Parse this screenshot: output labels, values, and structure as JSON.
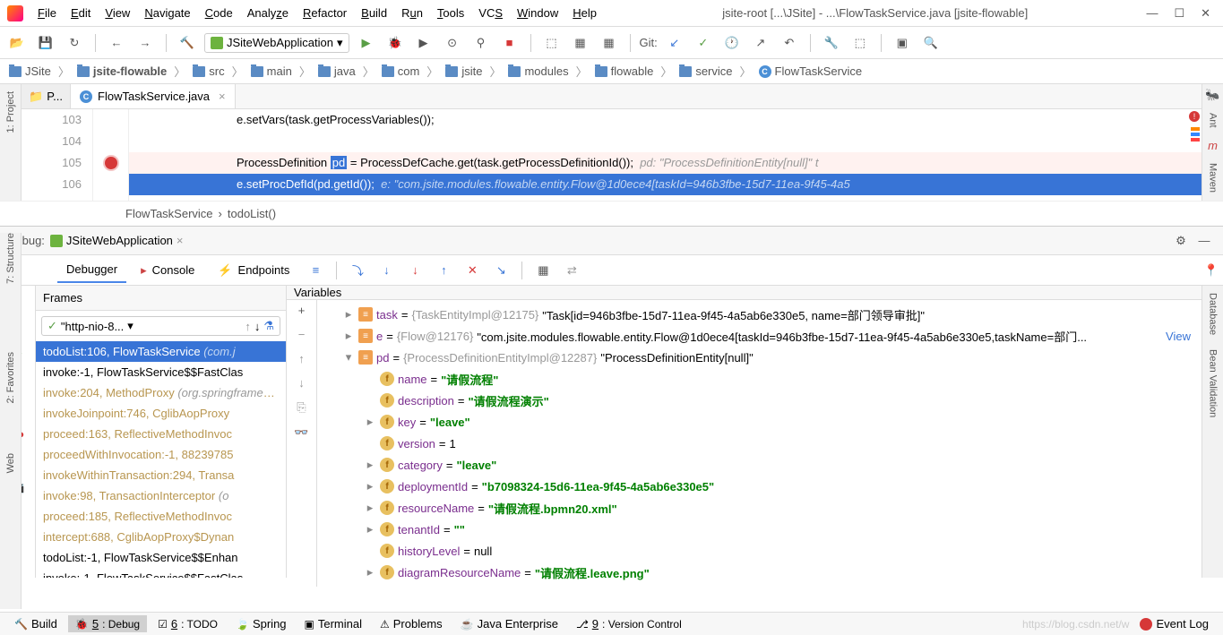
{
  "window": {
    "title": "jsite-root [...\\JSite] - ...\\FlowTaskService.java [jsite-flowable]"
  },
  "menu": {
    "file": "File",
    "edit": "Edit",
    "view": "View",
    "navigate": "Navigate",
    "code": "Code",
    "analyze": "Analyze",
    "refactor": "Refactor",
    "build": "Build",
    "run": "Run",
    "tools": "Tools",
    "vcs": "VCS",
    "window": "Window",
    "help": "Help"
  },
  "toolbar": {
    "run_config": "JSiteWebApplication",
    "git_label": "Git:"
  },
  "breadcrumb": [
    {
      "icon": "folder",
      "label": "JSite"
    },
    {
      "icon": "folder",
      "label": "jsite-flowable",
      "bold": true
    },
    {
      "icon": "folder",
      "label": "src"
    },
    {
      "icon": "folder",
      "label": "main"
    },
    {
      "icon": "folder",
      "label": "java"
    },
    {
      "icon": "folder",
      "label": "com"
    },
    {
      "icon": "folder",
      "label": "jsite"
    },
    {
      "icon": "folder",
      "label": "modules"
    },
    {
      "icon": "folder",
      "label": "flowable"
    },
    {
      "icon": "folder",
      "label": "service"
    },
    {
      "icon": "class",
      "label": "FlowTaskService"
    }
  ],
  "left_sidebar": {
    "project": "1: Project",
    "structure": "7: Structure",
    "favorites": "2: Favorites",
    "web": "Web"
  },
  "right_sidebar": {
    "ant": "Ant",
    "maven": "Maven",
    "database": "Database",
    "bean_validation": "Bean Validation"
  },
  "editor": {
    "side_tab": "P...",
    "file_tab": "FlowTaskService.java",
    "lines": {
      "l103_no": "103",
      "l103": "e.setVars(task.getProcessVariables());",
      "l104_no": "104",
      "l105_no": "105",
      "l105_pre": "ProcessDefinition ",
      "l105_hl": "pd",
      "l105_post": " = ProcessDefCache.get(task.getProcessDefinitionId());",
      "l105_comment": "pd: \"ProcessDefinitionEntity[null]\"  t",
      "l106_no": "106",
      "l106": "e.setProcDefId(pd.getId());",
      "l106_comment": "e: \"com.jsite.modules.flowable.entity.Flow@1d0ece4[taskId=946b3fbe-15d7-11ea-9f45-4a5"
    },
    "crumb1": "FlowTaskService",
    "crumb2": "todoList()"
  },
  "debug": {
    "title": "Debug:",
    "config": "JSiteWebApplication",
    "tabs": {
      "debugger": "Debugger",
      "console": "Console",
      "endpoints": "Endpoints"
    },
    "frames_label": "Frames",
    "vars_label": "Variables",
    "thread": "\"http-nio-8...",
    "frames": [
      {
        "text": "todoList:106, FlowTaskService",
        "pkg": "(com.j",
        "selected": true
      },
      {
        "text": "invoke:-1, FlowTaskService$$FastClas"
      },
      {
        "text": "invoke:204, MethodProxy",
        "pkg": "(org.springframework.cglib.proxy)",
        "lib": true
      },
      {
        "text": "invokeJoinpoint:746, CglibAopProxy",
        "lib": true
      },
      {
        "text": "proceed:163, ReflectiveMethodInvoc",
        "lib": true
      },
      {
        "text": "proceedWithInvocation:-1, 88239785",
        "lib": true
      },
      {
        "text": "invokeWithinTransaction:294, Transa",
        "lib": true
      },
      {
        "text": "invoke:98, TransactionInterceptor",
        "pkg": "(o",
        "lib": true
      },
      {
        "text": "proceed:185, ReflectiveMethodInvoc",
        "lib": true
      },
      {
        "text": "intercept:688, CglibAopProxy$Dynan",
        "lib": true
      },
      {
        "text": "todoList:-1, FlowTaskService$$Enhan"
      },
      {
        "text": "invoke:-1, FlowTaskService$$FastClas"
      }
    ],
    "vars": [
      {
        "level": 1,
        "arrow": "▸",
        "icon": "obj",
        "name": "task",
        "eq": " = ",
        "type": "{TaskEntityImpl@12175}",
        "val": " \"Task[id=946b3fbe-15d7-11ea-9f45-4a5ab6e330e5, name=部门领导审批]\""
      },
      {
        "level": 1,
        "arrow": "▸",
        "icon": "obj",
        "name": "e",
        "eq": " = ",
        "type": "{Flow@12176}",
        "val": " \"com.jsite.modules.flowable.entity.Flow@1d0ece4[taskId=946b3fbe-15d7-11ea-9f45-4a5ab6e330e5,taskName=部门...",
        "link": "View"
      },
      {
        "level": 1,
        "arrow": "▾",
        "icon": "obj",
        "name": "pd",
        "eq": " = ",
        "type": "{ProcessDefinitionEntityImpl@12287}",
        "val": " \"ProcessDefinitionEntity[null]\""
      },
      {
        "level": 2,
        "arrow": "",
        "icon": "field",
        "name": "name",
        "eq": " = ",
        "str": "\"请假流程\""
      },
      {
        "level": 2,
        "arrow": "",
        "icon": "field",
        "name": "description",
        "eq": " = ",
        "str": "\"请假流程演示\""
      },
      {
        "level": 2,
        "arrow": "▸",
        "icon": "field",
        "name": "key",
        "eq": " = ",
        "str": "\"leave\""
      },
      {
        "level": 2,
        "arrow": "",
        "icon": "field",
        "name": "version",
        "eq": " = ",
        "val": "1"
      },
      {
        "level": 2,
        "arrow": "▸",
        "icon": "field",
        "name": "category",
        "eq": " = ",
        "str": "\"leave\""
      },
      {
        "level": 2,
        "arrow": "▸",
        "icon": "field",
        "name": "deploymentId",
        "eq": " = ",
        "str": "\"b7098324-15d6-11ea-9f45-4a5ab6e330e5\""
      },
      {
        "level": 2,
        "arrow": "▸",
        "icon": "field",
        "name": "resourceName",
        "eq": " = ",
        "str": "\"请假流程.bpmn20.xml\""
      },
      {
        "level": 2,
        "arrow": "▸",
        "icon": "field",
        "name": "tenantId",
        "eq": " = ",
        "str": "\"\""
      },
      {
        "level": 2,
        "arrow": "",
        "icon": "field",
        "name": "historyLevel",
        "eq": " = ",
        "val": "null"
      },
      {
        "level": 2,
        "arrow": "▸",
        "icon": "field",
        "name": "diagramResourceName",
        "eq": " = ",
        "str": "\"请假流程.leave.png\""
      }
    ]
  },
  "statusbar": {
    "build": "Build",
    "debug": "5: Debug",
    "todo": "6: TODO",
    "spring": "Spring",
    "terminal": "Terminal",
    "problems": "Problems",
    "java_ee": "Java Enterprise",
    "vcs": "9: Version Control",
    "event_log": "Event Log",
    "watermark": "https://blog.csdn.net/w"
  }
}
